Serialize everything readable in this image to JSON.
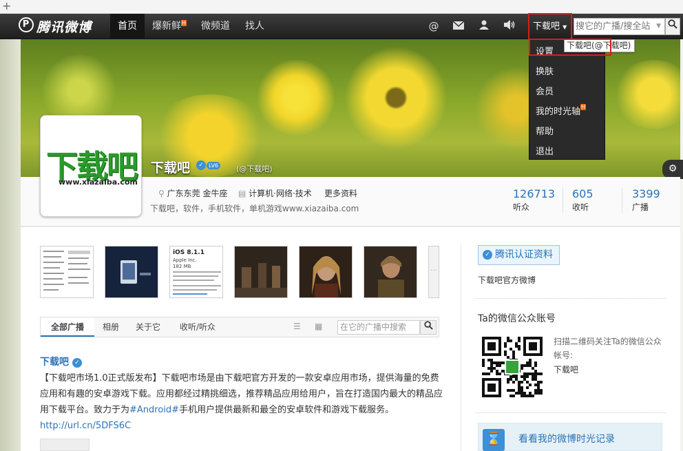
{
  "nav": {
    "logo": "腾讯微博",
    "logo_mark": "P",
    "items": [
      {
        "label": "首页",
        "active": true
      },
      {
        "label": "爆新鲜",
        "badge": "H"
      },
      {
        "label": "微频道"
      },
      {
        "label": "找人"
      }
    ],
    "icons": [
      "at-icon",
      "mail-icon",
      "user-icon",
      "sound-icon"
    ],
    "user_label": "下载吧",
    "search_placeholder": "搜它的广播/搜全站"
  },
  "dropdown": {
    "items": [
      {
        "label": "设置"
      },
      {
        "label": "换肤"
      },
      {
        "label": "会员"
      },
      {
        "label": "我的时光轴",
        "badge": "H"
      },
      {
        "label": "帮助"
      },
      {
        "label": "退出"
      }
    ],
    "tooltip": "下载吧(@下载吧)"
  },
  "profile": {
    "name": "下载吧",
    "level": "LV6",
    "handle": "(@下载吧)",
    "avatar_text": "下载吧",
    "avatar_url": "www.xiazaiba.com",
    "location": "广东东莞 金牛座",
    "industry": "计算机·网络·技术",
    "more": "更多资料",
    "description": "下载吧，软件，手机软件，单机游戏www.xiazaiba.com",
    "stats": [
      {
        "value": "126713",
        "label": "听众"
      },
      {
        "value": "605",
        "label": "收听"
      },
      {
        "value": "3399",
        "label": "广播"
      }
    ]
  },
  "thumbs": {
    "t3_title": "iOS 8.1.1",
    "t3_sub": "Apple Inc.",
    "t3_size": "182 MB"
  },
  "tabs": {
    "items": [
      "全部广播",
      "相册",
      "关于它",
      "收听/听众"
    ],
    "search_placeholder": "在它的广播中搜索"
  },
  "post": {
    "author": "下载吧",
    "body_1": "【下载吧市场1.0正式版发布】下载吧市场是由下载吧官方开发的一款安卓应用市场，提供海量的免费应用和有趣的安卓游戏下载。应用都经过精挑细选，推荐精品应用给用户，旨在打造国内最大的精品应用下载平台。致力于为",
    "tag": "#Android#",
    "body_2": "手机用户提供最新和最全的安卓软件和游戏下载服务。",
    "link": "http://url.cn/5DFS6C"
  },
  "sidebar": {
    "cert_label": "腾讯认证资料",
    "cert_desc": "下载吧官方微博",
    "wechat_title": "Ta的微信公众账号",
    "wechat_hint": "扫描二维码关注Ta的微信公众帐号:",
    "wechat_name": "下载吧",
    "timeline_label": "看看我的微博时光记录"
  },
  "colors": {
    "accent": "#2b73b9",
    "highlight": "#e01a1a",
    "nav_bg": "#2a2a2a"
  }
}
